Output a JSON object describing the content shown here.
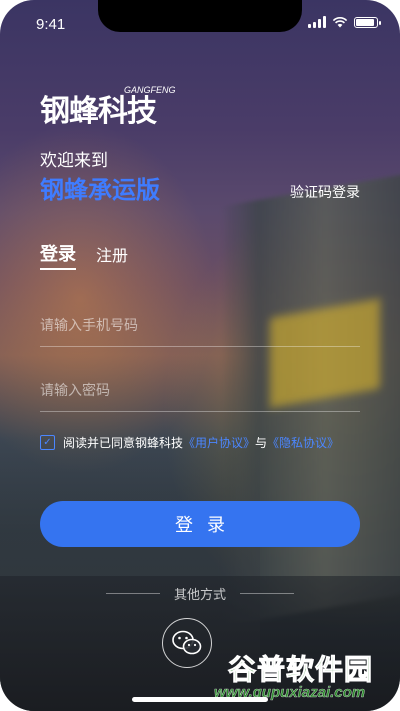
{
  "status_bar": {
    "time": "9:41"
  },
  "logo": {
    "text": "钢蜂科技",
    "sub": "GANGFENG"
  },
  "header": {
    "welcome": "欢迎来到",
    "app_name": "钢蜂承运版",
    "sms_login": "验证码登录"
  },
  "tabs": [
    {
      "label": "登录",
      "active": true
    },
    {
      "label": "注册",
      "active": false
    }
  ],
  "form": {
    "phone_placeholder": "请输入手机号码",
    "password_placeholder": "请输入密码"
  },
  "agreement": {
    "checked": true,
    "prefix": "阅读并已同意钢蜂科技",
    "user_agreement": "《用户协议》",
    "and": "与",
    "privacy": "《隐私协议》"
  },
  "login_button": "登录",
  "other": {
    "label": "其他方式",
    "wechat_icon": "wechat-icon"
  },
  "watermark": {
    "cn": "谷普软件园",
    "url": "www.gupuxiazai.com"
  },
  "colors": {
    "accent": "#3574f0",
    "link": "#4b86ff"
  }
}
